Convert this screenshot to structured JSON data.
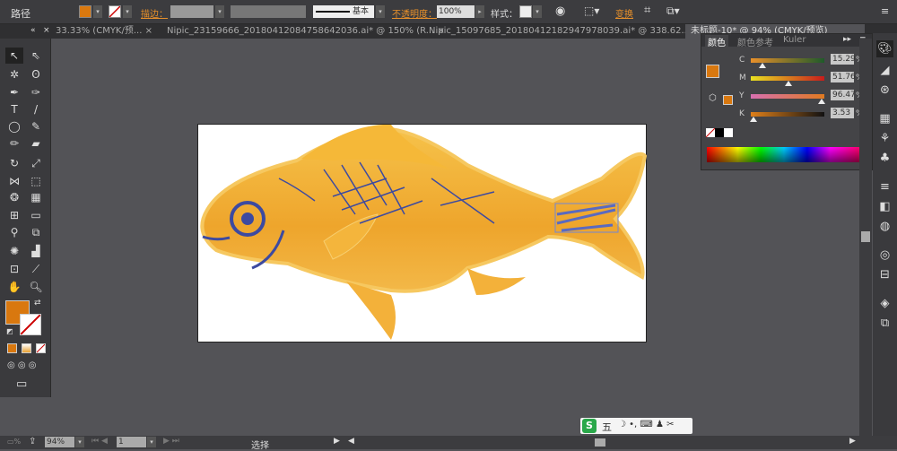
{
  "control_bar": {
    "object_type": "路径",
    "stroke_label": "描边：",
    "stroke_profile": "基本",
    "opacity_label": "不透明度：",
    "opacity_value": "100%",
    "style_label": "样式：",
    "transform_label": "变换",
    "fill_color": "#d9780f"
  },
  "tabs": [
    {
      "label": "33.33% (CMYK/预..."
    },
    {
      "label": "Nipic_23159666_20180412084758642036.ai* @ 150% (R..."
    },
    {
      "label": "Nipic_15097685_20180412182947978039.ai* @ 338.62..."
    },
    {
      "label": "未标题-10* @ 94% (CMYK/预览)",
      "active": true
    }
  ],
  "color_panel": {
    "tabs": [
      "颜色",
      "颜色参考",
      "Kuler"
    ],
    "channels": [
      {
        "name": "C",
        "value": "15.29",
        "percent": 15.29
      },
      {
        "name": "M",
        "value": "51.76",
        "percent": 51.76
      },
      {
        "name": "Y",
        "value": "96.47",
        "percent": 96.47
      },
      {
        "name": "K",
        "value": "3.53",
        "percent": 3.53
      }
    ],
    "unit": "%"
  },
  "status_bar": {
    "zoom": "94%",
    "page": "1",
    "tool_status": "选择"
  },
  "ime_bar": {
    "label": "五"
  }
}
